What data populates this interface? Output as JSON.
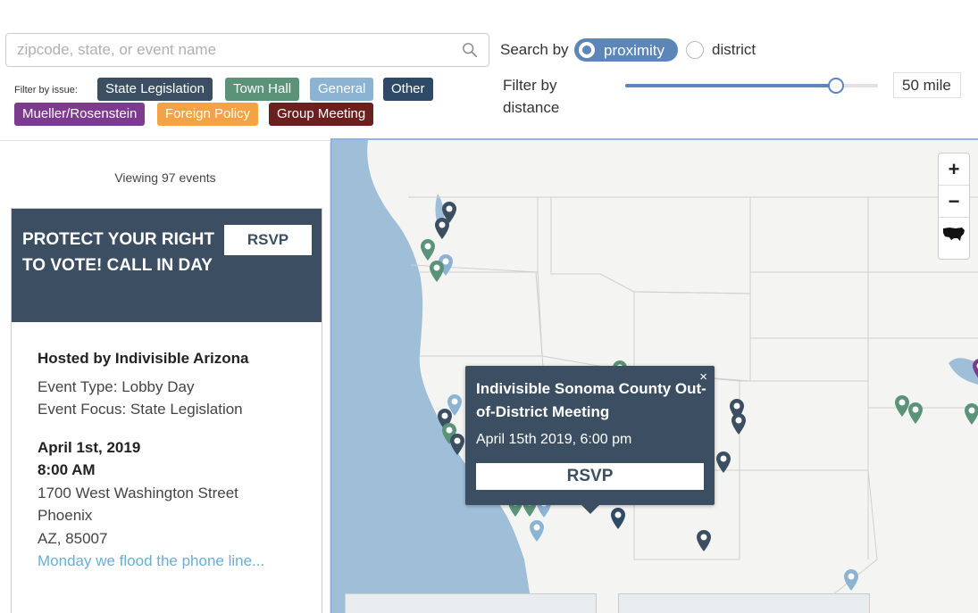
{
  "search": {
    "placeholder": "zipcode, state, or event name",
    "value": ""
  },
  "filters": {
    "label": "Filter by issue:",
    "chips": [
      {
        "label": "State Legislation",
        "color": "#3c4f62"
      },
      {
        "label": "Town Hall",
        "color": "#5a9378"
      },
      {
        "label": "General",
        "color": "#8db3d3"
      },
      {
        "label": "Other",
        "color": "#2f4a66"
      },
      {
        "label": "Mueller/Rosenstein",
        "color": "#7c3b8e"
      },
      {
        "label": "Foreign Policy",
        "color": "#f5a245"
      },
      {
        "label": "Group Meeting",
        "color": "#6b1f1f"
      }
    ]
  },
  "search_by": {
    "label": "Search by",
    "options": [
      "proximity",
      "district"
    ],
    "selected": "proximity"
  },
  "distance": {
    "label": "Filter by distance",
    "value": 50,
    "max": 60,
    "display": "50 mile"
  },
  "sidebar": {
    "viewing_count": "Viewing 97 events",
    "card": {
      "title": "PROTECT YOUR RIGHT TO VOTE! CALL IN DAY",
      "rsvp": "RSVP",
      "host": "Hosted by Indivisible Arizona",
      "event_type": "Event Type: Lobby Day",
      "event_focus": "Event Focus: State Legislation",
      "date": "April 1st, 2019",
      "time": "8:00 AM",
      "address_line1": "1700 West Washington Street",
      "city": "Phoenix",
      "state_zip": "AZ, 85007",
      "description": "Monday we flood the phone line..."
    }
  },
  "map": {
    "zoom_in": "+",
    "zoom_out": "−",
    "reset_icon": "us-map-icon",
    "popup": {
      "title": "Indivisible Sonoma County Out-of-District Meeting",
      "date": "April 15th 2019, 6:00 pm",
      "rsvp": "RSVP",
      "close": "×"
    },
    "colors": {
      "water": "#9fbfd8",
      "land": "#f4f4f2",
      "marker_dark": "#3c4f62",
      "marker_green": "#5a9378",
      "marker_light": "#8db3d3",
      "marker_purple": "#7c3b8e"
    }
  }
}
